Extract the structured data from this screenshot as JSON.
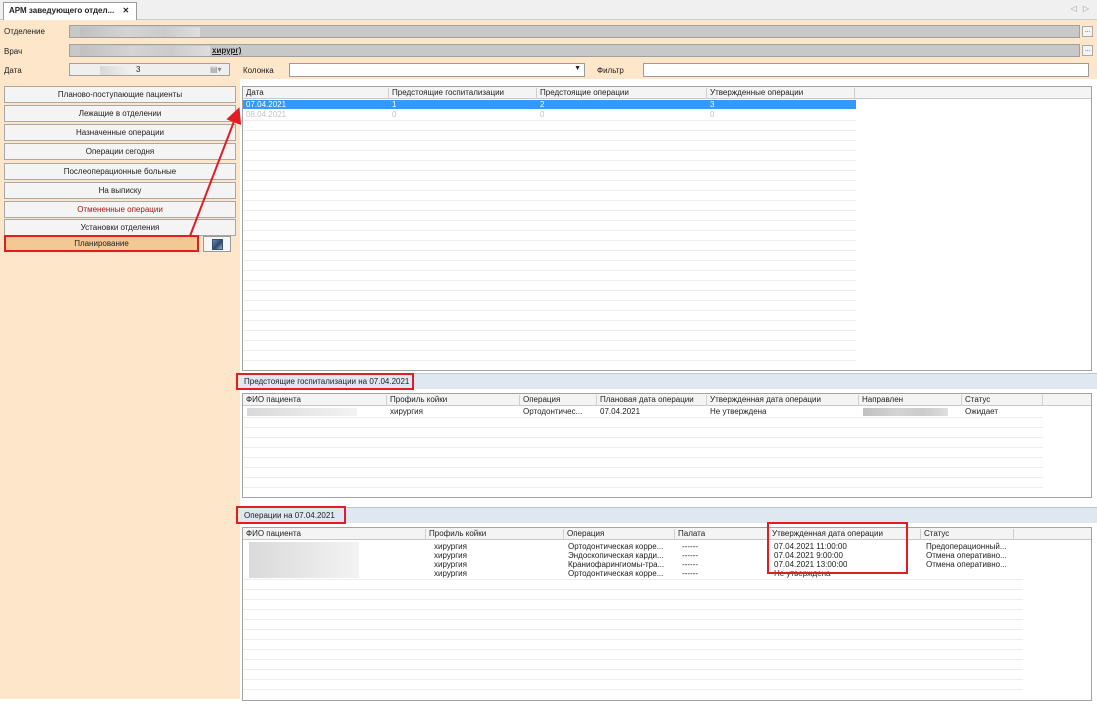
{
  "window": {
    "tab_label": "АРМ заведующего отдел...",
    "tab_close": "✕",
    "nav_arrows": "◁ ▷"
  },
  "form": {
    "dept_label": "Отделение",
    "doctor_label": "Врач",
    "doctor_value_suffix": "хирург)",
    "date_label": "Дата",
    "date_value_suffix": "3",
    "column_label": "Колонка",
    "filter_label": "Фильтр",
    "ellipsis": "..."
  },
  "nav": {
    "items": [
      {
        "label": "Планово-поступающие пациенты"
      },
      {
        "label": "Лежащие в отделении"
      },
      {
        "label": "Назначенные операции"
      },
      {
        "label": "Операции сегодня"
      },
      {
        "label": "Послеоперационные больные"
      },
      {
        "label": "На выписку"
      },
      {
        "label": "Отмененные операции"
      },
      {
        "label": "Установки отделения"
      },
      {
        "label": "Планирование"
      }
    ]
  },
  "summary_grid": {
    "headers": [
      "Дата",
      "Предстоящие госпитализации",
      "Предстоящие операции",
      "Утвержденные операции"
    ],
    "rows": [
      [
        "07.04.2021",
        "1",
        "2",
        "3"
      ],
      [
        "08.04.2021",
        "0",
        "0",
        "0"
      ]
    ]
  },
  "hospitalizations": {
    "title": "Предстоящие госпитализации на 07.04.2021",
    "headers": [
      "ФИО пациента",
      "Профиль койки",
      "Операция",
      "Плановая дата операции",
      "Утвержденная дата операции",
      "Направлен",
      "Статус"
    ],
    "rows": [
      [
        "",
        "хирургия",
        "Ортодонтичес...",
        "07.04.2021",
        "Не утверждена",
        "",
        "Ожидает"
      ]
    ]
  },
  "operations": {
    "title": "Операции на 07.04.2021",
    "headers": [
      "ФИО пациента",
      "Профиль койки",
      "Операция",
      "Палата",
      "Утвержденная дата операции",
      "Статус"
    ],
    "rows": [
      [
        "",
        "хирургия",
        "Ортодонтическая корре...",
        "------",
        "07.04.2021 11:00:00",
        "Предоперационный..."
      ],
      [
        "",
        "хирургия",
        "Эндоскопическая карди...",
        "------",
        "07.04.2021 9:00:00",
        "Отмена оперативно..."
      ],
      [
        "",
        "хирургия",
        "Краниофарингиомы-тра...",
        "------",
        "07.04.2021 13:00:00",
        "Отмена оперативно..."
      ],
      [
        "",
        "хирургия",
        "Ортодонтическая корре...",
        "------",
        "Не утверждена",
        ""
      ]
    ]
  },
  "colors": {
    "panel_bg": "#fde6c9",
    "selection": "#3399ff",
    "highlight": "#e11d23",
    "active_nav": "#f4c893"
  }
}
